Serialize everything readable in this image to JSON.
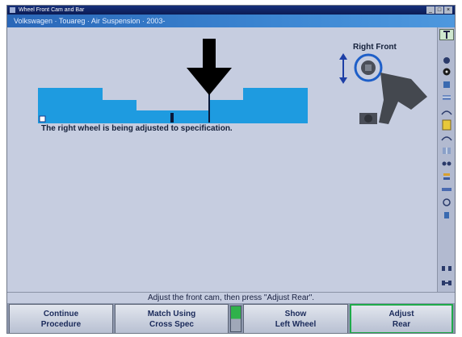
{
  "window": {
    "title": "Wheel Front Cam and Bar",
    "controls": [
      "_",
      "□",
      "×"
    ]
  },
  "vehicle": {
    "text": "Volkswagen · Touareg · Air Suspension · 2003-"
  },
  "main": {
    "wheel_label": "Right Front",
    "message": "The right wheel is being adjusted to specification.",
    "reading_position": 0.41,
    "colors": {
      "gauge_blue": "#1e9be0",
      "gauge_dark": "#173a8a",
      "arrow": "#000000",
      "indicator_green": "#2fb24a"
    },
    "icons": [
      "down-arrow-pointer-icon",
      "vertical-adjust-icon",
      "wheel-hub-icon",
      "suspension-knuckle-icon"
    ]
  },
  "toolbar": {
    "icons": [
      "tool-icon",
      "camber-icon",
      "tire-icon",
      "align-icon",
      "caster-icon",
      "arc-icon",
      "yellow-marker-icon",
      "arc-icon",
      "grid-icon",
      "toe-icon",
      "ride-height-icon",
      "level-icon",
      "brake-icon",
      "adjust-icon",
      "settings-icon",
      "print-icon"
    ]
  },
  "status": {
    "text": "Adjust the front cam, then press \"Adjust Rear\"."
  },
  "softkeys": [
    {
      "label": "Continue\nProcedure",
      "active": false
    },
    {
      "label": "Match Using\nCross Spec",
      "active": false
    },
    {
      "label": "Show\nLeft Wheel",
      "active": false
    },
    {
      "label": "Adjust\nRear",
      "active": true
    }
  ]
}
